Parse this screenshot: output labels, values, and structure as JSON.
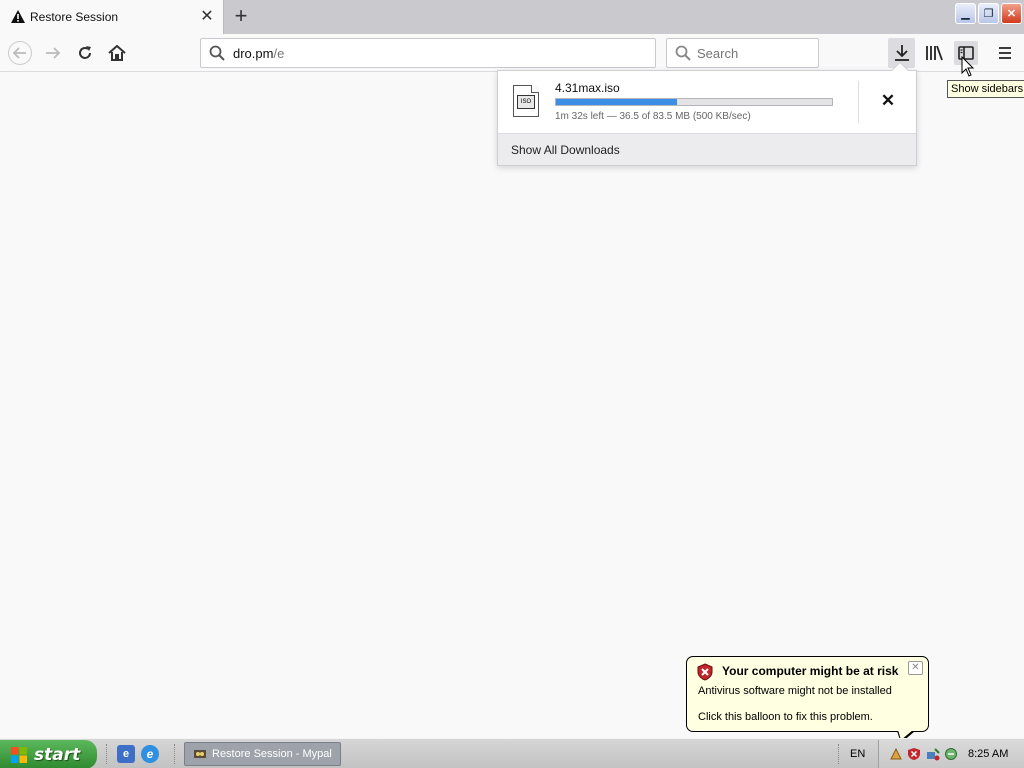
{
  "tab": {
    "title": "Restore Session",
    "new_tab_label": "+"
  },
  "navbar": {
    "url_domain": "dro.pm",
    "url_path": "/e",
    "search_placeholder": "Search"
  },
  "download": {
    "filename": "4.31max.iso",
    "status": "1m 32s left — 36.5 of 83.5 MB (500 KB/sec)",
    "progress_fraction": 0.437,
    "show_all_label": "Show All Downloads"
  },
  "tooltip": {
    "text": "Show sidebars"
  },
  "balloon": {
    "title": "Your computer might be at risk",
    "line1": "Antivirus software might not be installed",
    "line2": "Click this balloon to fix this problem."
  },
  "taskbar": {
    "start_label": "start",
    "task_item": "Restore Session - Mypal",
    "language": "EN",
    "clock": "8:25 AM"
  },
  "colors": {
    "progress": "#3a8ee6",
    "start_green": "#3c9a3c",
    "balloon_bg": "#ffffe1"
  }
}
